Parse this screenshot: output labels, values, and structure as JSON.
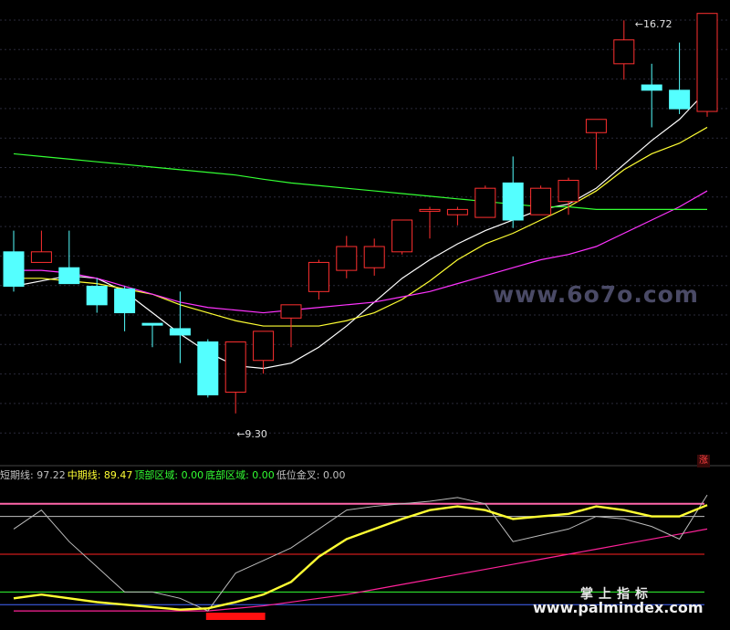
{
  "chart_data": {
    "type": "candlestick",
    "price_axis": {
      "min": 8.4,
      "max": 17.0
    },
    "candles": [
      {
        "o": 12.35,
        "h": 12.75,
        "l": 11.6,
        "c": 11.7
      },
      {
        "o": 12.15,
        "h": 12.75,
        "l": 12.15,
        "c": 12.35
      },
      {
        "o": 12.05,
        "h": 12.75,
        "l": 11.95,
        "c": 11.75
      },
      {
        "o": 11.7,
        "h": 11.85,
        "l": 11.2,
        "c": 11.35
      },
      {
        "o": 11.65,
        "h": 11.7,
        "l": 10.85,
        "c": 11.2
      },
      {
        "o": 11.0,
        "h": 11.0,
        "l": 10.55,
        "c": 10.98
      },
      {
        "o": 10.9,
        "h": 11.6,
        "l": 10.25,
        "c": 10.78
      },
      {
        "o": 10.65,
        "h": 10.7,
        "l": 9.6,
        "c": 9.65
      },
      {
        "o": 9.7,
        "h": 10.65,
        "l": 9.3,
        "c": 10.65
      },
      {
        "o": 10.3,
        "h": 10.85,
        "l": 10.05,
        "c": 10.85
      },
      {
        "o": 11.1,
        "h": 11.35,
        "l": 10.55,
        "c": 11.35
      },
      {
        "o": 11.6,
        "h": 12.2,
        "l": 11.45,
        "c": 12.15
      },
      {
        "o": 12.0,
        "h": 12.65,
        "l": 11.85,
        "c": 12.45
      },
      {
        "o": 12.05,
        "h": 12.6,
        "l": 11.9,
        "c": 12.45
      },
      {
        "o": 12.35,
        "h": 12.95,
        "l": 12.3,
        "c": 12.95
      },
      {
        "o": 13.15,
        "h": 13.2,
        "l": 12.6,
        "c": 13.15
      },
      {
        "o": 13.05,
        "h": 13.2,
        "l": 12.85,
        "c": 13.15
      },
      {
        "o": 13.0,
        "h": 13.6,
        "l": 13.0,
        "c": 13.55
      },
      {
        "o": 13.65,
        "h": 14.15,
        "l": 12.8,
        "c": 12.95
      },
      {
        "o": 13.05,
        "h": 13.6,
        "l": 13.05,
        "c": 13.55
      },
      {
        "o": 13.3,
        "h": 13.75,
        "l": 13.05,
        "c": 13.7
      },
      {
        "o": 14.6,
        "h": 14.85,
        "l": 13.9,
        "c": 14.85
      },
      {
        "o": 15.9,
        "h": 16.72,
        "l": 15.6,
        "c": 16.35
      },
      {
        "o": 15.5,
        "h": 15.9,
        "l": 14.7,
        "c": 15.4
      },
      {
        "o": 15.4,
        "h": 16.3,
        "l": 14.95,
        "c": 15.05
      },
      {
        "o": 15.0,
        "h": 16.85,
        "l": 14.9,
        "c": 16.85
      }
    ],
    "ma_lines": [
      {
        "color": "#ffffff",
        "values": [
          11.7,
          11.8,
          11.9,
          11.85,
          11.6,
          11.2,
          10.8,
          10.45,
          10.2,
          10.15,
          10.25,
          10.55,
          10.95,
          11.4,
          11.85,
          12.2,
          12.5,
          12.75,
          12.95,
          13.15,
          13.25,
          13.55,
          14.0,
          14.45,
          14.85,
          15.4
        ]
      },
      {
        "color": "#ffff33",
        "values": [
          11.85,
          11.85,
          11.8,
          11.75,
          11.65,
          11.55,
          11.35,
          11.2,
          11.05,
          10.95,
          10.95,
          10.95,
          11.05,
          11.2,
          11.45,
          11.8,
          12.2,
          12.5,
          12.7,
          12.95,
          13.2,
          13.5,
          13.9,
          14.2,
          14.4,
          14.7
        ]
      },
      {
        "color": "#ff33ff",
        "values": [
          12.0,
          12.0,
          11.95,
          11.85,
          11.7,
          11.55,
          11.4,
          11.3,
          11.25,
          11.2,
          11.25,
          11.3,
          11.35,
          11.4,
          11.5,
          11.6,
          11.75,
          11.9,
          12.05,
          12.2,
          12.3,
          12.45,
          12.7,
          12.95,
          13.2,
          13.5
        ]
      },
      {
        "color": "#33ff33",
        "values": [
          14.2,
          14.15,
          14.1,
          14.05,
          14.0,
          13.95,
          13.9,
          13.85,
          13.8,
          13.72,
          13.65,
          13.6,
          13.55,
          13.5,
          13.45,
          13.4,
          13.35,
          13.3,
          13.25,
          13.2,
          13.2,
          13.15,
          13.15,
          13.15,
          13.15,
          13.15
        ]
      }
    ],
    "high_label": "16.72",
    "low_label": "9.30",
    "indicator": {
      "ylim": [
        0,
        100
      ],
      "legend": [
        {
          "label": "短期线: ",
          "value": "97.22",
          "color": "#c0c0c0"
        },
        {
          "label": "中期线: ",
          "value": "89.47",
          "color": "#ffff33"
        },
        {
          "label": "顶部区域: ",
          "value": "0.00",
          "color": "#33ff33"
        },
        {
          "label": "底部区域: ",
          "value": "0.00",
          "color": "#33ff33"
        },
        {
          "label": "低位金叉: ",
          "value": "0.00",
          "color": "#c0c0c0"
        }
      ],
      "hlines": [
        {
          "value": 90,
          "color": "#ff66aa"
        },
        {
          "value": 80,
          "color": "#c0c0c0"
        },
        {
          "value": 50,
          "color": "#ff2222"
        },
        {
          "value": 20,
          "color": "#33ff33"
        },
        {
          "value": 10,
          "color": "#4466ff"
        }
      ],
      "short_line": [
        70,
        85,
        60,
        40,
        20,
        20,
        15,
        5,
        35,
        45,
        55,
        70,
        85,
        88,
        90,
        92,
        95,
        90,
        60,
        65,
        70,
        80,
        78,
        72,
        62,
        97
      ],
      "mid_line": [
        15,
        18,
        15,
        12,
        10,
        8,
        6,
        7,
        12,
        18,
        28,
        48,
        62,
        70,
        78,
        85,
        88,
        85,
        78,
        80,
        82,
        88,
        85,
        80,
        80,
        89
      ],
      "pink_line": [
        5,
        5,
        5,
        5,
        5,
        5,
        5,
        5,
        7,
        9,
        12,
        15,
        18,
        22,
        26,
        30,
        34,
        38,
        42,
        46,
        50,
        54,
        58,
        62,
        66,
        70
      ],
      "red_block": {
        "from": 7,
        "to": 9
      }
    }
  },
  "watermarks": {
    "site1": "www.6o7o.com",
    "site2_title": "掌上指标",
    "site2": "www.palmindex.com"
  },
  "flag_text": "涨"
}
